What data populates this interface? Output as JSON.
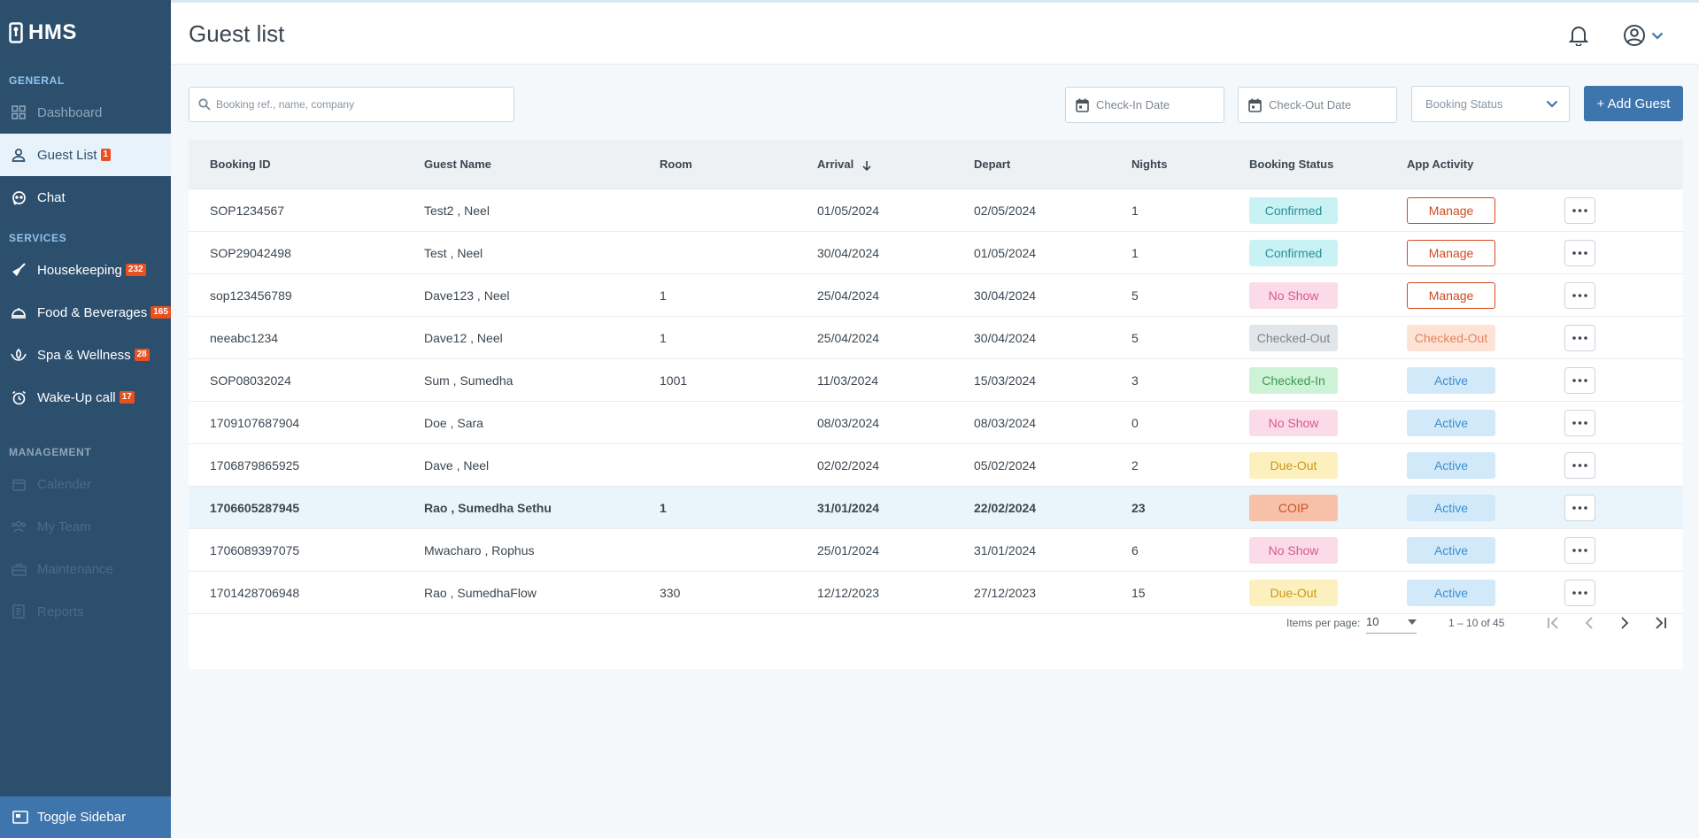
{
  "app": {
    "brand": "HMS"
  },
  "sidebar": {
    "general_label": "GENERAL",
    "services_label": "SERVICES",
    "management_label": "MANAGEMENT",
    "general_items": [
      {
        "label": "Dashboard",
        "icon": "grid-icon"
      },
      {
        "label": "Guest List",
        "icon": "person-icon",
        "badge": "1",
        "active": true
      },
      {
        "label": "Chat",
        "icon": "chat-icon"
      }
    ],
    "service_items": [
      {
        "label": "Housekeeping",
        "icon": "broom-icon",
        "badge": "232"
      },
      {
        "label": "Food & Beverages",
        "icon": "food-icon",
        "badge": "165"
      },
      {
        "label": "Spa & Wellness",
        "icon": "spa-icon",
        "badge": "28"
      },
      {
        "label": "Wake-Up call",
        "icon": "alarm-icon",
        "badge": "17"
      }
    ],
    "management_items": [
      {
        "label": "Calender",
        "icon": "calendar-icon"
      },
      {
        "label": "My Team",
        "icon": "team-icon"
      },
      {
        "label": "Maintenance",
        "icon": "toolbox-icon"
      },
      {
        "label": "Reports",
        "icon": "report-icon"
      }
    ],
    "toggle_label": "Toggle Sidebar"
  },
  "header": {
    "title": "Guest list"
  },
  "filters": {
    "search_placeholder": "Booking ref., name, company",
    "checkin_placeholder": "Check-In Date",
    "checkout_placeholder": "Check-Out Date",
    "status_placeholder": "Booking Status",
    "add_guest_label": "+ Add Guest"
  },
  "table": {
    "headers": {
      "booking_id": "Booking ID",
      "guest_name": "Guest Name",
      "room": "Room",
      "arrival": "Arrival",
      "depart": "Depart",
      "nights": "Nights",
      "booking_status": "Booking Status",
      "app_activity": "App Activity"
    },
    "rows": [
      {
        "id": "SOP1234567",
        "name": "Test2 , Neel",
        "room": "",
        "arrival": "01/05/2024",
        "depart": "02/05/2024",
        "nights": "1",
        "status": "Confirmed",
        "activity": "Manage"
      },
      {
        "id": "SOP29042498",
        "name": "Test , Neel",
        "room": "",
        "arrival": "30/04/2024",
        "depart": "01/05/2024",
        "nights": "1",
        "status": "Confirmed",
        "activity": "Manage"
      },
      {
        "id": "sop123456789",
        "name": "Dave123 , Neel",
        "room": "1",
        "arrival": "25/04/2024",
        "depart": "30/04/2024",
        "nights": "5",
        "status": "No Show",
        "activity": "Manage"
      },
      {
        "id": "neeabc1234",
        "name": "Dave12 , Neel",
        "room": "1",
        "arrival": "25/04/2024",
        "depart": "30/04/2024",
        "nights": "5",
        "status": "Checked-Out",
        "activity": "Checked-Out"
      },
      {
        "id": "SOP08032024",
        "name": "Sum , Sumedha",
        "room": "1001",
        "arrival": "11/03/2024",
        "depart": "15/03/2024",
        "nights": "3",
        "status": "Checked-In",
        "activity": "Active"
      },
      {
        "id": "1709107687904",
        "name": "Doe , Sara",
        "room": "",
        "arrival": "08/03/2024",
        "depart": "08/03/2024",
        "nights": "0",
        "status": "No Show",
        "activity": "Active"
      },
      {
        "id": "1706879865925",
        "name": "Dave , Neel",
        "room": "",
        "arrival": "02/02/2024",
        "depart": "05/02/2024",
        "nights": "2",
        "status": "Due-Out",
        "activity": "Active"
      },
      {
        "id": "1706605287945",
        "name": "Rao , Sumedha Sethu",
        "room": "1",
        "arrival": "31/01/2024",
        "depart": "22/02/2024",
        "nights": "23",
        "status": "COIP",
        "activity": "Active",
        "highlighted": true
      },
      {
        "id": "1706089397075",
        "name": "Mwacharo , Rophus",
        "room": "",
        "arrival": "25/01/2024",
        "depart": "31/01/2024",
        "nights": "6",
        "status": "No Show",
        "activity": "Active"
      },
      {
        "id": "1701428706948",
        "name": "Rao , SumedhaFlow",
        "room": "330",
        "arrival": "12/12/2023",
        "depart": "27/12/2023",
        "nights": "15",
        "status": "Due-Out",
        "activity": "Active"
      }
    ]
  },
  "status_colors": {
    "Confirmed": {
      "bg": "#c9f2f4",
      "fg": "#2b8f9a"
    },
    "No Show": {
      "bg": "#fbdbe7",
      "fg": "#d85a8a"
    },
    "Checked-Out": {
      "bg": "#e3e6e9",
      "fg": "#7a858e"
    },
    "Checked-In": {
      "bg": "#cdf2d6",
      "fg": "#3a9a55"
    },
    "Due-Out": {
      "bg": "#fdf0bf",
      "fg": "#c99a12"
    },
    "COIP": {
      "bg": "#f7c0a8",
      "fg": "#c8532a"
    }
  },
  "activity_colors": {
    "Manage": {
      "bg": "#ffffff",
      "fg": "#d24a1e",
      "border": "#d24a1e"
    },
    "Checked-Out": {
      "bg": "#fde3d6",
      "fg": "#e8825a",
      "border": "#fde3d6"
    },
    "Active": {
      "bg": "#d2e9fa",
      "fg": "#3a8fd0",
      "border": "#d2e9fa"
    }
  },
  "pagination": {
    "items_per_page_label": "Items per page:",
    "items_per_page": "10",
    "range_label": "1 – 10 of 45"
  }
}
